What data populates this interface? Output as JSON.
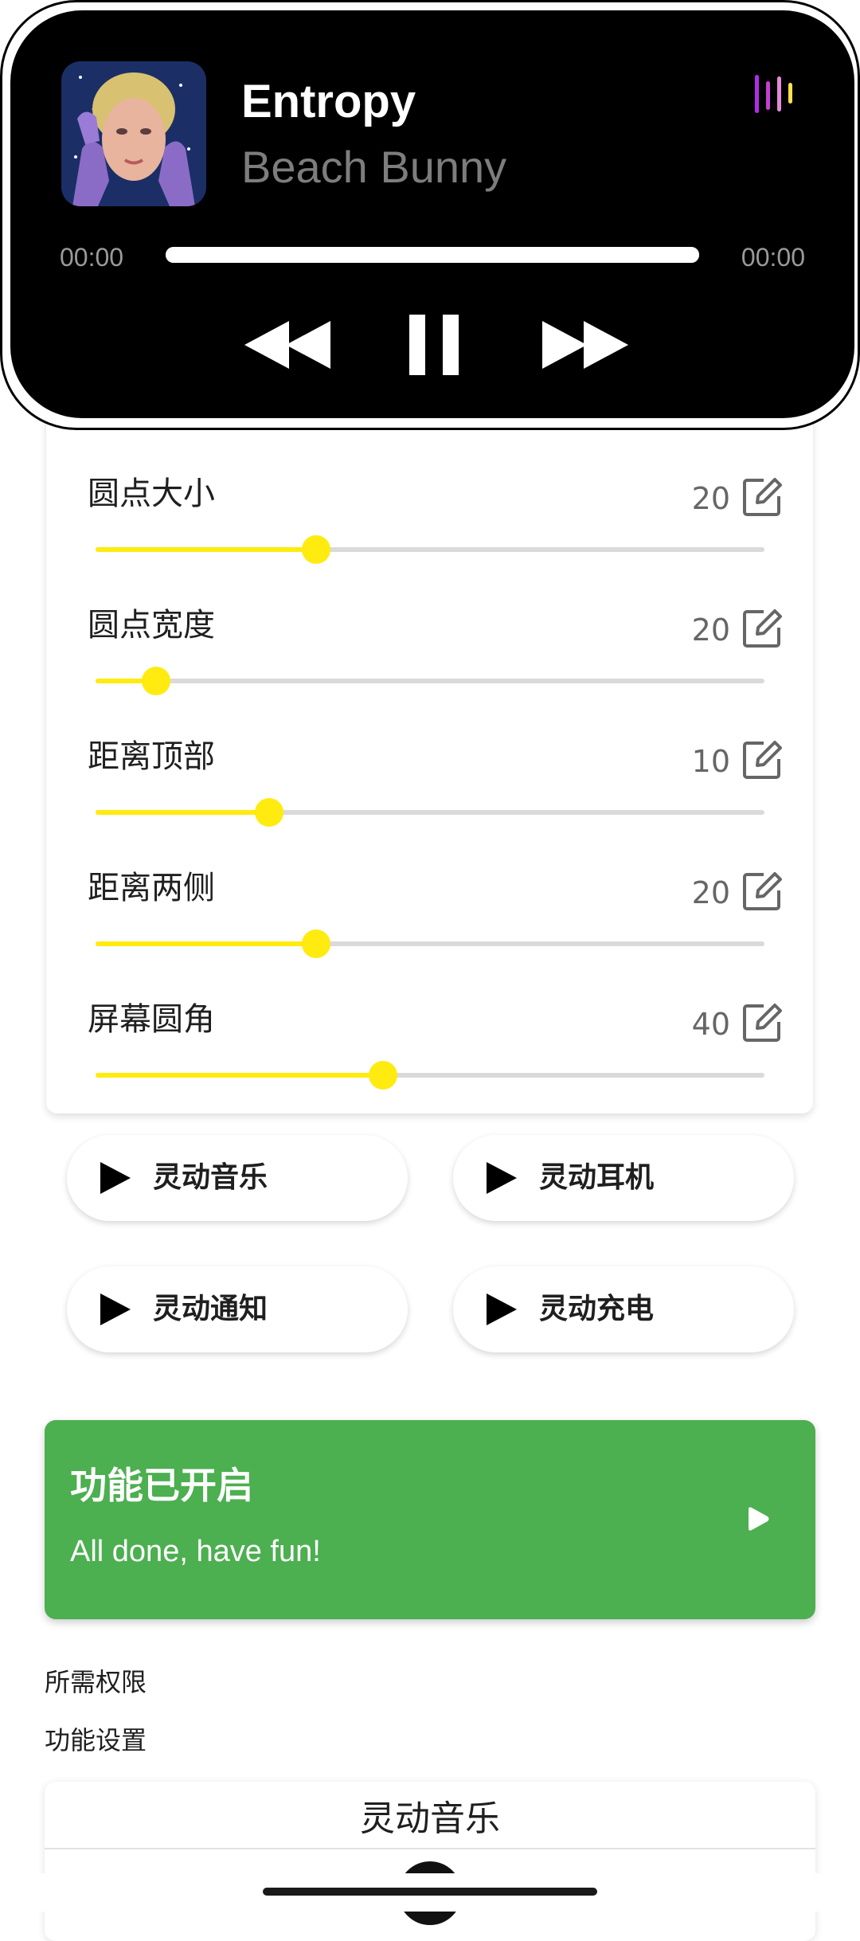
{
  "player": {
    "title": "Entropy",
    "artist": "Beach Bunny",
    "elapsed": "00:00",
    "total": "00:00",
    "progress": 1.0,
    "controls": {
      "rewind": "rewind-icon",
      "pause": "pause-icon",
      "forward": "fast-forward-icon"
    },
    "visualizer_colors": [
      "#b22ce6",
      "#c73dd4",
      "#e38ad8",
      "#ffe14d"
    ]
  },
  "settings": [
    {
      "label": "圆点大小",
      "value": "20",
      "level": 0.33
    },
    {
      "label": "圆点宽度",
      "value": "20",
      "level": 0.09
    },
    {
      "label": "距离顶部",
      "value": "10",
      "level": 0.26
    },
    {
      "label": "距离两侧",
      "value": "20",
      "level": 0.33
    },
    {
      "label": "屏幕圆角",
      "value": "40",
      "level": 0.43
    }
  ],
  "features": [
    {
      "label": "灵动音乐",
      "icon": "play-icon"
    },
    {
      "label": "灵动耳机",
      "icon": "play-icon"
    },
    {
      "label": "灵动通知",
      "icon": "play-icon"
    },
    {
      "label": "灵动充电",
      "icon": "play-icon"
    }
  ],
  "status": {
    "title": "功能已开启",
    "subtitle": "All done, have fun!",
    "color": "#4caf50"
  },
  "links": {
    "permissions": "所需权限",
    "settings": "功能设置"
  },
  "bottom_card": {
    "title": "灵动音乐"
  },
  "colors": {
    "accent": "#ffeb0f",
    "island": "#000000",
    "track": "#dadada"
  }
}
